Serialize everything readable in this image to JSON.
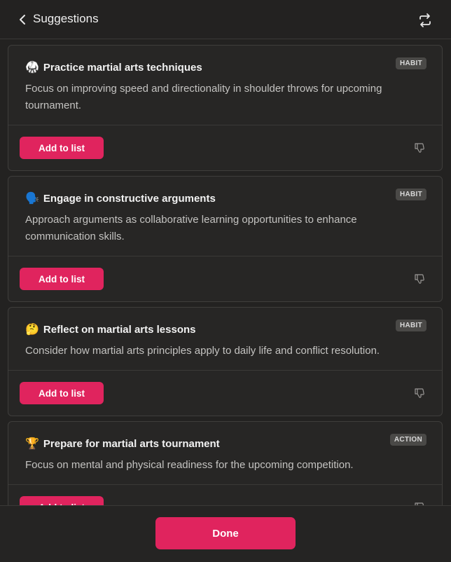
{
  "header": {
    "title": "Suggestions",
    "back_icon": "chevron-left-icon",
    "swap_icon": "swap-arrows-icon"
  },
  "suggestions": [
    {
      "emoji": "🥋",
      "title": "Practice martial arts techniques",
      "badge": "HABIT",
      "description": "Focus on improving speed and directionality in shoulder throws for upcoming tournament.",
      "button": "Add to list"
    },
    {
      "emoji": "🗣️",
      "title": "Engage in constructive arguments",
      "badge": "HABIT",
      "description": "Approach arguments as collaborative learning opportunities to enhance communication skills.",
      "button": "Add to list"
    },
    {
      "emoji": "🤔",
      "title": "Reflect on martial arts lessons",
      "badge": "HABIT",
      "description": "Consider how martial arts principles apply to daily life and conflict resolution.",
      "button": "Add to list"
    },
    {
      "emoji": "🏆",
      "title": "Prepare for martial arts tournament",
      "badge": "ACTION",
      "description": "Focus on mental and physical readiness for the upcoming competition.",
      "button": "Add to list"
    }
  ],
  "footer": {
    "done_label": "Done"
  },
  "colors": {
    "accent": "#e0245e",
    "background": "#232221",
    "card": "#272625"
  }
}
